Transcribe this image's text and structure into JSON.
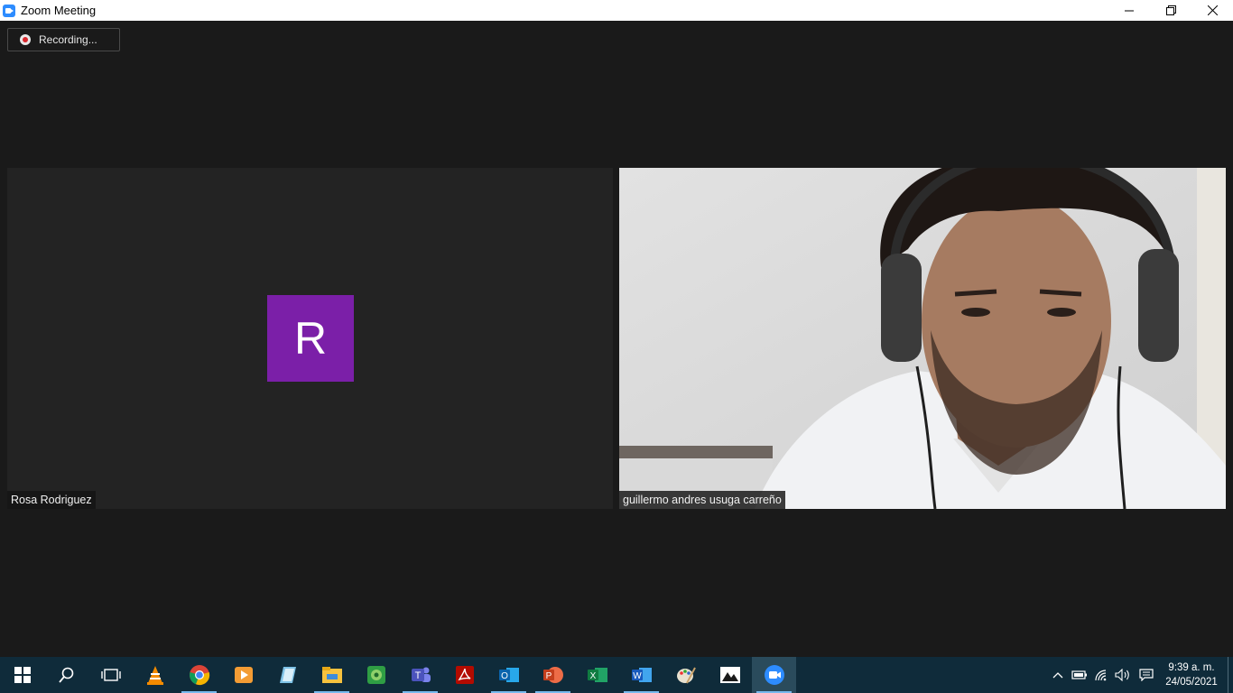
{
  "window": {
    "title": "Zoom Meeting"
  },
  "recording": {
    "label": "Recording..."
  },
  "participants": [
    {
      "name": "Rosa Rodriguez",
      "initial": "R",
      "avatar_color": "#7b1fa8",
      "video": false
    },
    {
      "name": "guillermo andres usuga carreño",
      "video": true
    }
  ],
  "taskbar": {
    "apps": [
      "windows-start-icon",
      "search-icon",
      "task-view-icon",
      "vlc-icon",
      "chrome-icon",
      "media-player-icon",
      "notepad-icon",
      "file-explorer-icon",
      "greenshot-icon",
      "teams-icon",
      "acrobat-icon",
      "outlook-icon",
      "powerpoint-icon",
      "excel-icon",
      "word-icon",
      "paint-icon",
      "photos-icon",
      "zoom-icon"
    ],
    "active_app": "zoom-icon",
    "clock": {
      "time": "9:39 a. m.",
      "date": "24/05/2021"
    }
  },
  "colors": {
    "background": "#1a1a1a",
    "tile": "#232323",
    "taskbar": "#0f2b3a",
    "accent": "#2d8cff"
  }
}
